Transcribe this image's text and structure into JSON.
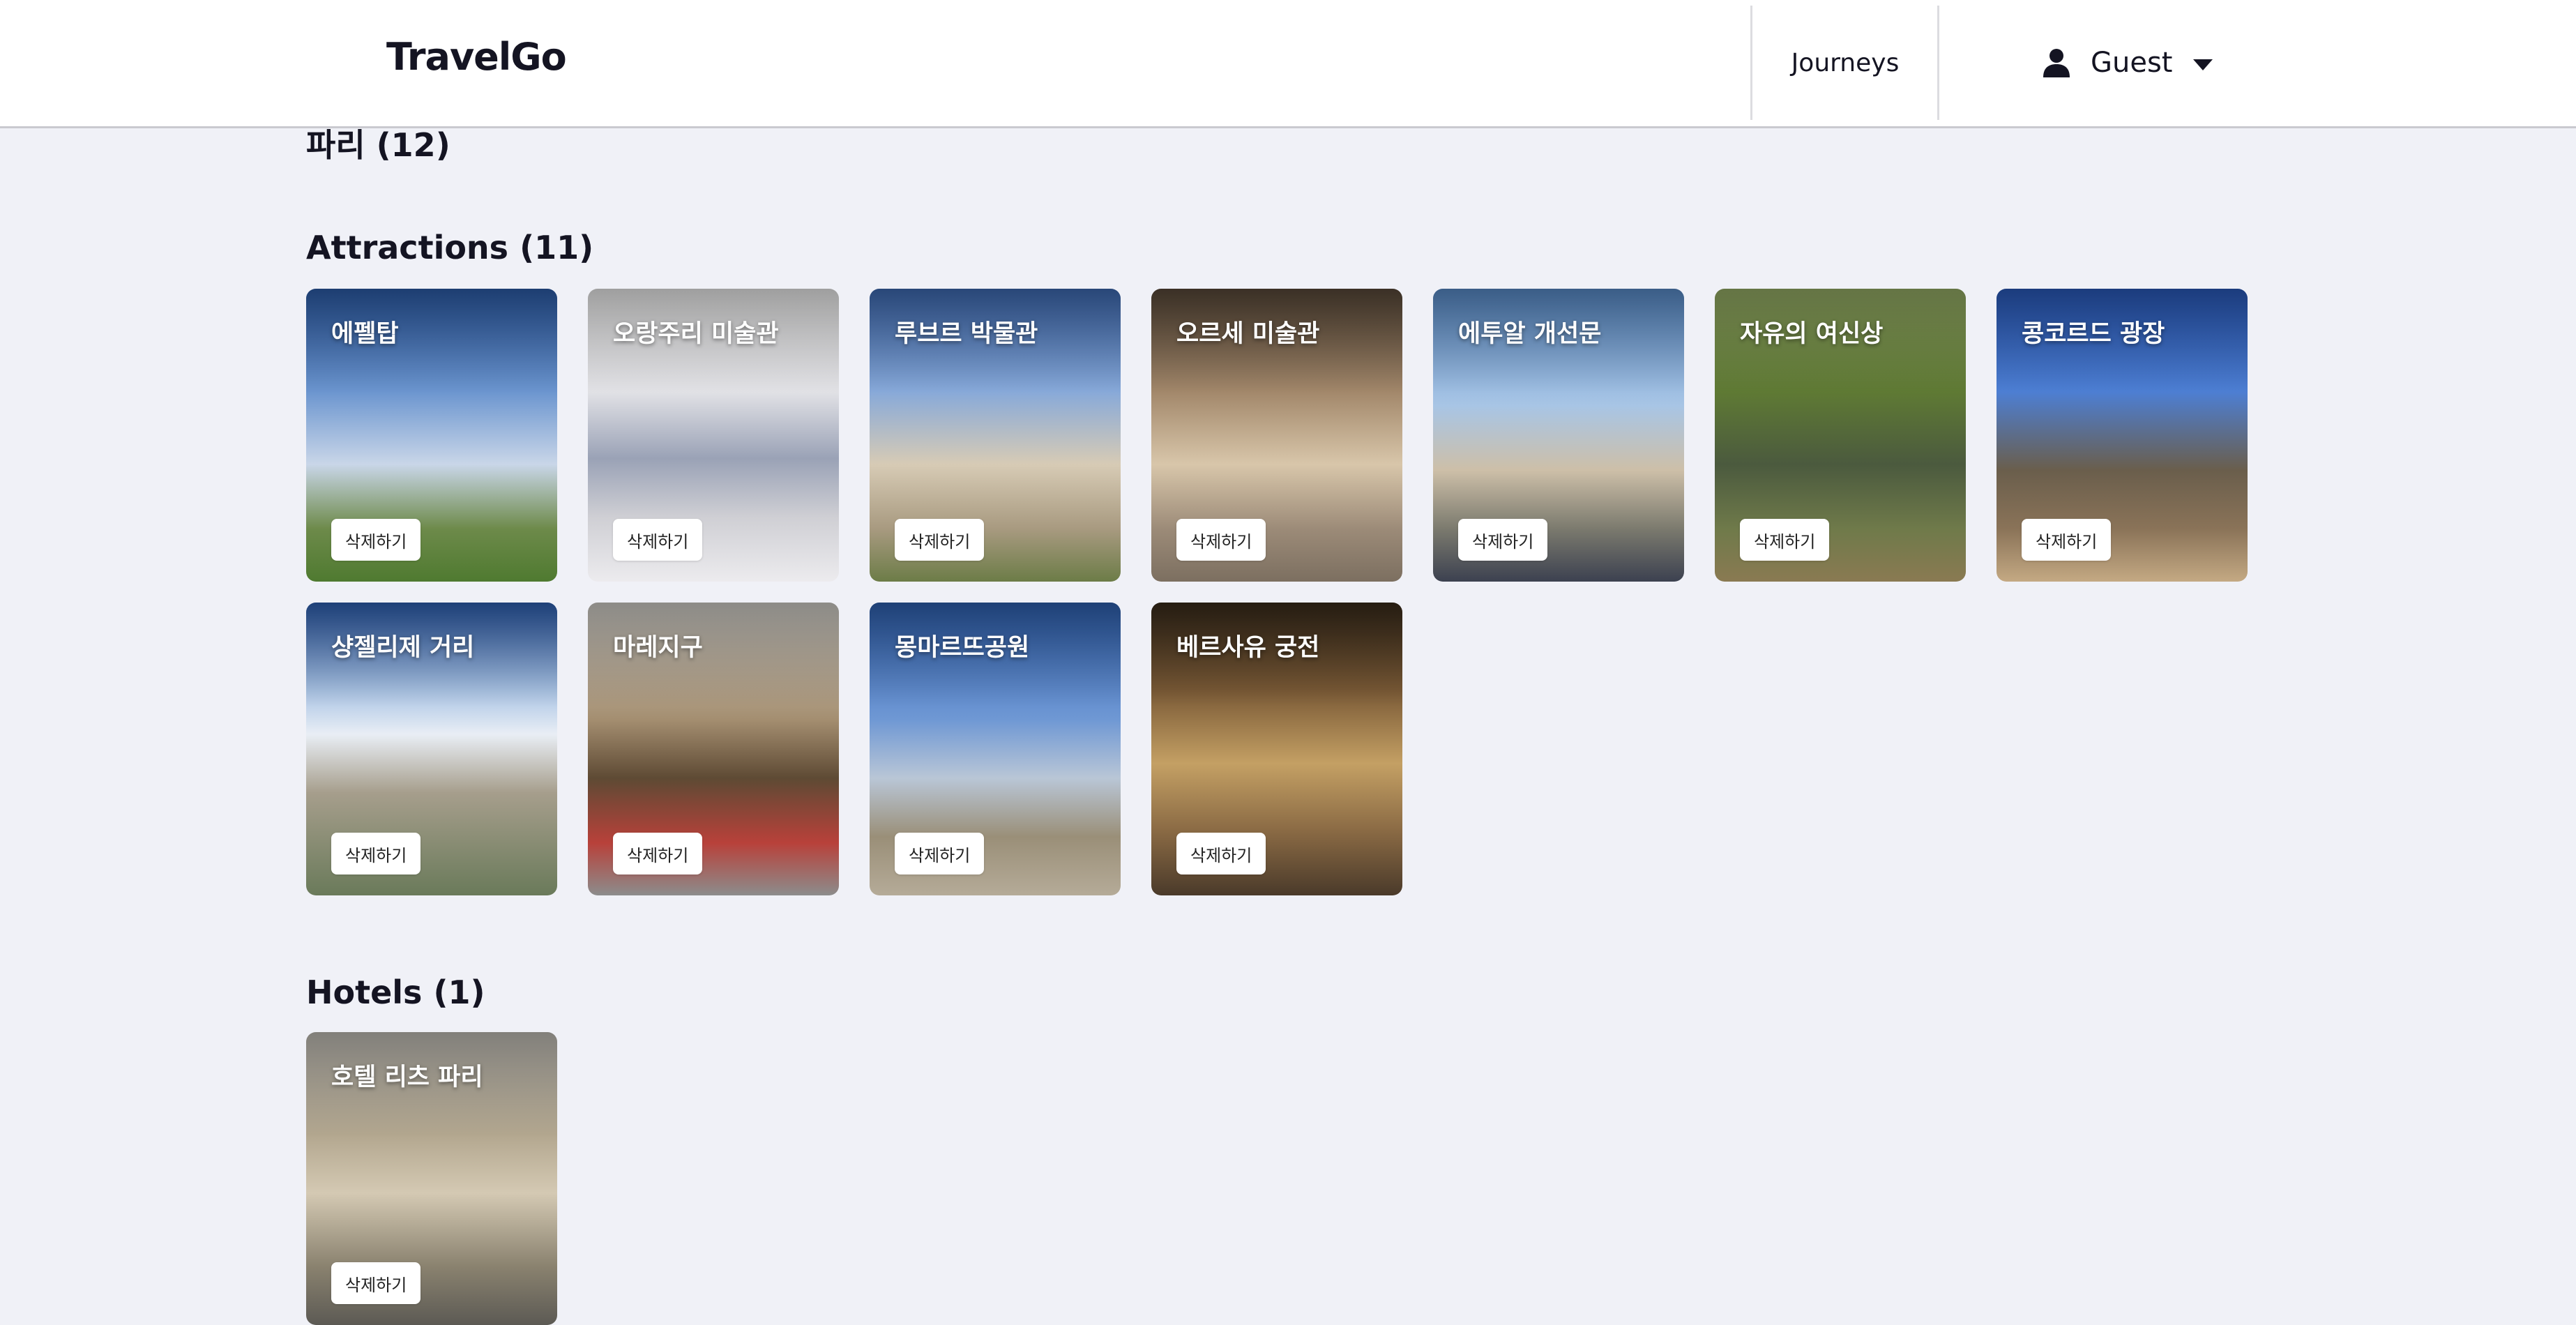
{
  "header": {
    "brand": "TravelGo",
    "nav_journeys": "Journeys",
    "user_label": "Guest"
  },
  "city": {
    "title": "파리 (12)"
  },
  "attractions": {
    "title": "Attractions (11)",
    "delete_label": "삭제하기",
    "items": [
      {
        "name": "에펠탑",
        "bg": "linear-gradient(180deg,#2d5fae 0%,#6b95cf 35%,#c9d6e8 60%,#6d8a4a 82%,#4f7a30 100%)"
      },
      {
        "name": "오랑주리 미술관",
        "bg": "linear-gradient(180deg,#f4f4f4 0%,#e2e2e6 35%,#9aa2b6 58%,#cfcfd4 78%,#ecebee 100%)"
      },
      {
        "name": "루브르 박물관",
        "bg": "linear-gradient(180deg,#3f6db8 0%,#87a9d9 35%,#d7cbb5 60%,#a89a80 82%,#6c7c47 100%)"
      },
      {
        "name": "오르세 미술관",
        "bg": "linear-gradient(180deg,#5a4a3a 0%,#a2876a 35%,#d8c6aa 60%,#9c8b78 82%,#7c6f60 100%)"
      },
      {
        "name": "에투알 개선문",
        "bg": "linear-gradient(180deg,#5a8fcf 0%,#a8c5e5 40%,#cdbfa8 62%,#7b7a6e 82%,#3c4150 100%)"
      },
      {
        "name": "자유의 여신상",
        "bg": "linear-gradient(180deg,#9bb36a 0%,#5f7a34 35%,#4b5a3e 60%,#6f7a4a 82%,#8a7a52 100%)"
      },
      {
        "name": "콩코르드 광장",
        "bg": "linear-gradient(180deg,#2a5cc0 0%,#4d7fd4 35%,#6a5e4c 62%,#8a7358 82%,#c4a983 100%)"
      },
      {
        "name": "샹젤리제 거리",
        "bg": "linear-gradient(180deg,#2e62b8 0%,#a9c3e4 30%,#e9eef5 45%,#a69e8c 65%,#6a7a5a 100%)"
      },
      {
        "name": "마레지구",
        "bg": "linear-gradient(180deg,#d8d6d0 0%,#a48e70 40%,#5e4a34 60%,#b8413a 82%,#8c8c8c 100%)"
      },
      {
        "name": "몽마르뜨공원",
        "bg": "linear-gradient(180deg,#2f63b6 0%,#6f98d4 40%,#b9c6d6 60%,#9a8f78 80%,#b5ab98 100%)"
      },
      {
        "name": "베르사유 궁전",
        "bg": "linear-gradient(180deg,#3a2c1c 0%,#7a5a36 30%,#c4a064 55%,#8a6a44 78%,#4a3a2a 100%)"
      }
    ]
  },
  "hotels": {
    "title": "Hotels (1)",
    "delete_label": "삭제하기",
    "items": [
      {
        "name": "호텔 리츠 파리",
        "bg": "linear-gradient(180deg,#c7c4bc 0%,#b3a78f 35%,#d4c9b3 55%,#8a826f 80%,#5c5a54 100%)"
      }
    ]
  }
}
